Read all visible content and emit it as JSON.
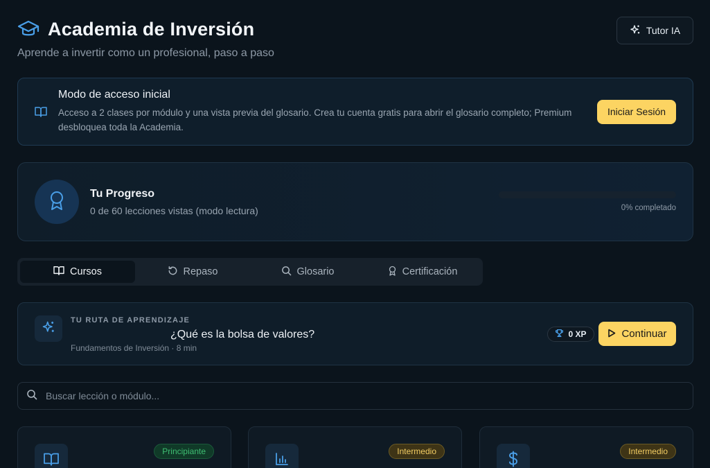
{
  "header": {
    "title": "Academia de Inversión",
    "subtitle": "Aprende a invertir como un profesional, paso a paso",
    "tutor_label": "Tutor IA"
  },
  "access": {
    "title": "Modo de acceso inicial",
    "description": "Acceso a 2 clases por módulo y una vista previa del glosario. Crea tu cuenta gratis para abrir el glosario completo; Premium desbloquea toda la Academia.",
    "login_label": "Iniciar Sesión"
  },
  "progress": {
    "title": "Tu Progreso",
    "subtitle": "0 de 60 lecciones vistas (modo lectura)",
    "percent_label": "0% completado",
    "fraction": 0
  },
  "tabs": [
    {
      "label": "Cursos",
      "active": true
    },
    {
      "label": "Repaso",
      "active": false
    },
    {
      "label": "Glosario",
      "active": false
    },
    {
      "label": "Certificación",
      "active": false
    }
  ],
  "route": {
    "label": "TU RUTA DE APRENDIZAJE",
    "lesson": "¿Qué es la bolsa de valores?",
    "meta": "Fundamentos de Inversión · 8 min",
    "xp": "0 XP",
    "continue_label": "Continuar"
  },
  "search": {
    "placeholder": "Buscar lección o módulo..."
  },
  "courses": [
    {
      "icon": "book-icon",
      "level": "Principiante",
      "level_color": "#3fbf73"
    },
    {
      "icon": "bar-chart-icon",
      "level": "Intermedio",
      "level_color": "#f3cd63"
    },
    {
      "icon": "dollar-icon",
      "level": "Intermedio",
      "level_color": "#f3cd63"
    }
  ],
  "colors": {
    "accent_yellow": "#fcd462",
    "accent_blue": "#4a9fe8",
    "background": "#0b141c"
  }
}
